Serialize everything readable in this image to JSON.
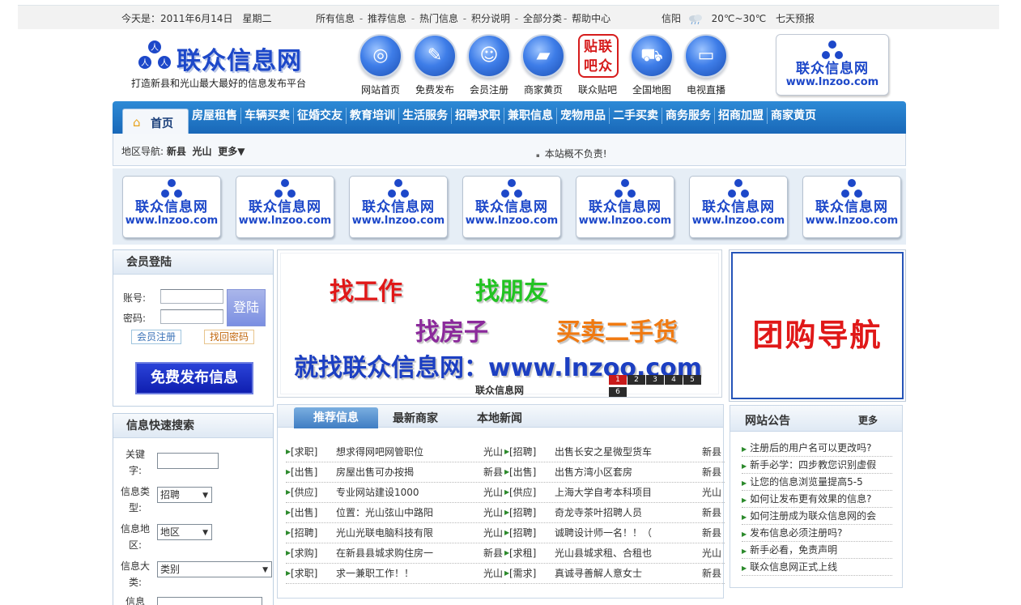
{
  "topbar": {
    "date": "今天是：2011年6月14日　星期二",
    "links": [
      "所有信息",
      "推荐信息",
      "热门信息",
      "积分说明",
      "全部分类",
      "帮助中心"
    ],
    "weather_city": "信阳",
    "weather_temp": "20℃~30℃",
    "weather_forecast": "七天预报"
  },
  "logo": {
    "name": "联众信息网",
    "slogan": "打造新县和光山最大最好的信息发布平台"
  },
  "nav_icons": [
    {
      "label": "网站首页",
      "icon": "globe-icon"
    },
    {
      "label": "免费发布",
      "icon": "pen-icon"
    },
    {
      "label": "会员注册",
      "icon": "users-icon"
    },
    {
      "label": "商家黄页",
      "icon": "folder-icon"
    },
    {
      "label": "联众贴吧",
      "icon": "stamp-icon",
      "stamp_text": "贴联吧众"
    },
    {
      "label": "全国地图",
      "icon": "car-icon"
    },
    {
      "label": "电视直播",
      "icon": "monitor-icon"
    }
  ],
  "brand_box": {
    "name": "联众信息网",
    "url": "www.lnzoo.com"
  },
  "main_nav": {
    "home": "首页",
    "items": [
      "房屋租售",
      "车辆买卖",
      "征婚交友",
      "教育培训",
      "生活服务",
      "招聘求职",
      "兼职信息",
      "宠物用品",
      "二手买卖",
      "商务服务",
      "招商加盟",
      "商家黄页"
    ]
  },
  "sub_nav": {
    "region_label": "地区导航:",
    "regions": [
      "新县",
      "光山"
    ],
    "more": "更多▼",
    "notice": "本站概不负责!"
  },
  "sponsors": [
    {
      "name": "联众信息网",
      "url": "www.lnzoo.com"
    },
    {
      "name": "联众信息网",
      "url": "www.lnzoo.com"
    },
    {
      "name": "联众信息网",
      "url": "www.lnzoo.com"
    },
    {
      "name": "联众信息网",
      "url": "www.lnzoo.com"
    },
    {
      "name": "联众信息网",
      "url": "www.lnzoo.com"
    },
    {
      "name": "联众信息网",
      "url": "www.lnzoo.com"
    },
    {
      "name": "联众信息网",
      "url": "www.lnzoo.com"
    }
  ],
  "login": {
    "title": "会员登陆",
    "account_label": "账号:",
    "password_label": "密码:",
    "login_button": "登陆",
    "register": "会员注册",
    "forgot": "找回密码",
    "free_post": "免费发布信息"
  },
  "search": {
    "title": "信息快速搜索",
    "keyword_label": "关键字:",
    "type_label": "信息类型:",
    "type_value": "招聘",
    "area_label": "信息地区:",
    "area_value": "地区",
    "category_label": "信息大类:",
    "category_value": "类别",
    "extra_label": "信息"
  },
  "banner": {
    "line1a": "找工作",
    "line1b": "找朋友",
    "line2a": "找房子",
    "line2b": "买卖二手货",
    "line3": "就找联众信息网：www.lnzoo.com",
    "pages": [
      "1",
      "2",
      "3",
      "4",
      "5",
      "6"
    ],
    "caption": "联众信息网",
    "colors": {
      "red": "#e01818",
      "green": "#22c322",
      "purple": "#8b2a9b",
      "orange": "#f07a12",
      "blue": "#1c3fc2"
    }
  },
  "tuangou": {
    "title": "团购导航"
  },
  "info": {
    "tabs": [
      "推荐信息",
      "最新商家",
      "本地新闻"
    ],
    "left": [
      {
        "cat": "[求职]",
        "title": "想求得网吧网管职位",
        "loc": "光山"
      },
      {
        "cat": "[出售]",
        "title": "房屋出售可办按揭",
        "loc": "新县"
      },
      {
        "cat": "[供应]",
        "title": "专业网站建设1000",
        "loc": "光山"
      },
      {
        "cat": "[出售]",
        "title": "位置：光山弦山中路阳",
        "loc": "光山"
      },
      {
        "cat": "[招聘]",
        "title": "光山光联电脑科技有限",
        "loc": "光山"
      },
      {
        "cat": "[求购]",
        "title": "在新县县城求购住房一",
        "loc": "新县"
      },
      {
        "cat": "[求职]",
        "title": "求一兼职工作！！",
        "loc": "光山"
      }
    ],
    "right": [
      {
        "cat": "[招聘]",
        "title": "出售长安之星微型货车",
        "loc": "新县"
      },
      {
        "cat": "[出售]",
        "title": "出售方湾小区套房",
        "loc": "新县"
      },
      {
        "cat": "[供应]",
        "title": "上海大学自考本科项目",
        "loc": "光山"
      },
      {
        "cat": "[招聘]",
        "title": "奇龙寺茶叶招聘人员",
        "loc": "新县"
      },
      {
        "cat": "[招聘]",
        "title": "诚聘设计师一名！！（",
        "loc": "新县"
      },
      {
        "cat": "[求租]",
        "title": "光山县城求租、合租也",
        "loc": "光山"
      },
      {
        "cat": "[需求]",
        "title": "真诚寻善解人意女士",
        "loc": "新县"
      }
    ]
  },
  "notice": {
    "title": "网站公告",
    "more": "更多",
    "items": [
      "注册后的用户名可以更改吗?",
      "新手必学：四步教您识别虚假",
      "让您的信息浏览量提高5-5",
      "如何让发布更有效果的信息?",
      "如何注册成为联众信息网的会",
      "发布信息必须注册吗?",
      "新手必看，免责声明",
      "联众信息网正式上线"
    ]
  }
}
